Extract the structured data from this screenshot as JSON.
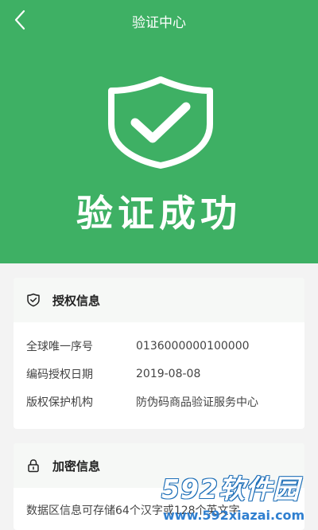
{
  "header": {
    "title": "验证中心",
    "back_icon": "chevron-left-icon"
  },
  "hero": {
    "status_text": "验证成功",
    "icon": "shield-check-icon",
    "color": "#3eb064"
  },
  "auth_card": {
    "title": "授权信息",
    "icon": "shield-check-icon",
    "rows": [
      {
        "label": "全球唯一序号",
        "value": "0136000000100000"
      },
      {
        "label": "编码授权日期",
        "value": "2019-08-08"
      },
      {
        "label": "版权保护机构",
        "value": "防伪码商品验证服务中心"
      }
    ]
  },
  "encryption_card": {
    "title": "加密信息",
    "icon": "lock-icon",
    "description": "数据区信息可存储64个汉字或128个英文字"
  },
  "watermark": {
    "brand": "592软件园",
    "url": "www.592xiazai.com"
  }
}
